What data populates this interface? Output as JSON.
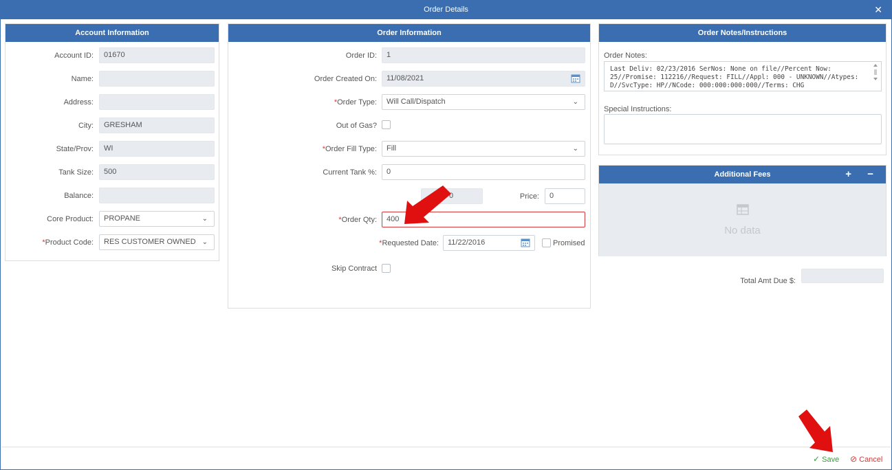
{
  "window": {
    "title": "Order Details",
    "close_glyph": "✕"
  },
  "account": {
    "header": "Account Information",
    "fields": {
      "account_id": {
        "label": "Account ID:",
        "value": "01670"
      },
      "name": {
        "label": "Name:",
        "value": ""
      },
      "address": {
        "label": "Address:",
        "value": ""
      },
      "city": {
        "label": "City:",
        "value": "GRESHAM"
      },
      "state": {
        "label": "State/Prov:",
        "value": "WI"
      },
      "tank_size": {
        "label": "Tank Size:",
        "value": "500"
      },
      "balance": {
        "label": "Balance:",
        "value": ""
      },
      "core_product": {
        "label": "Core Product:",
        "value": "PROPANE"
      },
      "product_code": {
        "label": "Product Code:",
        "value": "RES CUSTOMER OWNED"
      }
    }
  },
  "order": {
    "header": "Order Information",
    "order_id": {
      "label": "Order ID:",
      "value": "1"
    },
    "created_on": {
      "label": "Order Created On:",
      "value": "11/08/2021"
    },
    "order_type": {
      "label": "Order Type:",
      "value": "Will Call/Dispatch"
    },
    "out_of_gas": {
      "label": "Out of Gas?"
    },
    "fill_type": {
      "label": "Order Fill Type:",
      "value": "Fill"
    },
    "current_tank": {
      "label": "Current Tank %:",
      "value": "0"
    },
    "amount": {
      "label": "Am",
      "value": "0"
    },
    "price": {
      "label": "Price:",
      "value": "0"
    },
    "order_qty": {
      "label": "Order Qty:",
      "value": "400"
    },
    "requested_date": {
      "label": "Requested Date:",
      "value": "11/22/2016"
    },
    "promised": {
      "label": "Promised"
    },
    "skip_contract": {
      "label": "Skip Contract"
    }
  },
  "notes": {
    "header": "Order Notes/Instructions",
    "order_notes_label": "Order Notes:",
    "order_notes_text": "Last Deliv: 02/23/2016 SerNos: None on file//Percent Now: 25//Promise: 112216//Request: FILL//Appl: 000 - UNKNOWN//Atypes: D//SvcType: HP//NCode: 000:000:000:000//Terms: CHG",
    "special_label": "Special Instructions:",
    "special_value": ""
  },
  "fees": {
    "header": "Additional Fees",
    "add_glyph": "+",
    "remove_glyph": "−",
    "empty_text": "No data"
  },
  "totals": {
    "label": "Total Amt Due $:",
    "value": ""
  },
  "footer": {
    "save_label": "Save",
    "cancel_label": "Cancel"
  },
  "colors": {
    "header_blue": "#3a6eb0",
    "error_red": "#d43a3a",
    "save_green": "#3a9a3a",
    "annotation_red": "#e01010"
  }
}
